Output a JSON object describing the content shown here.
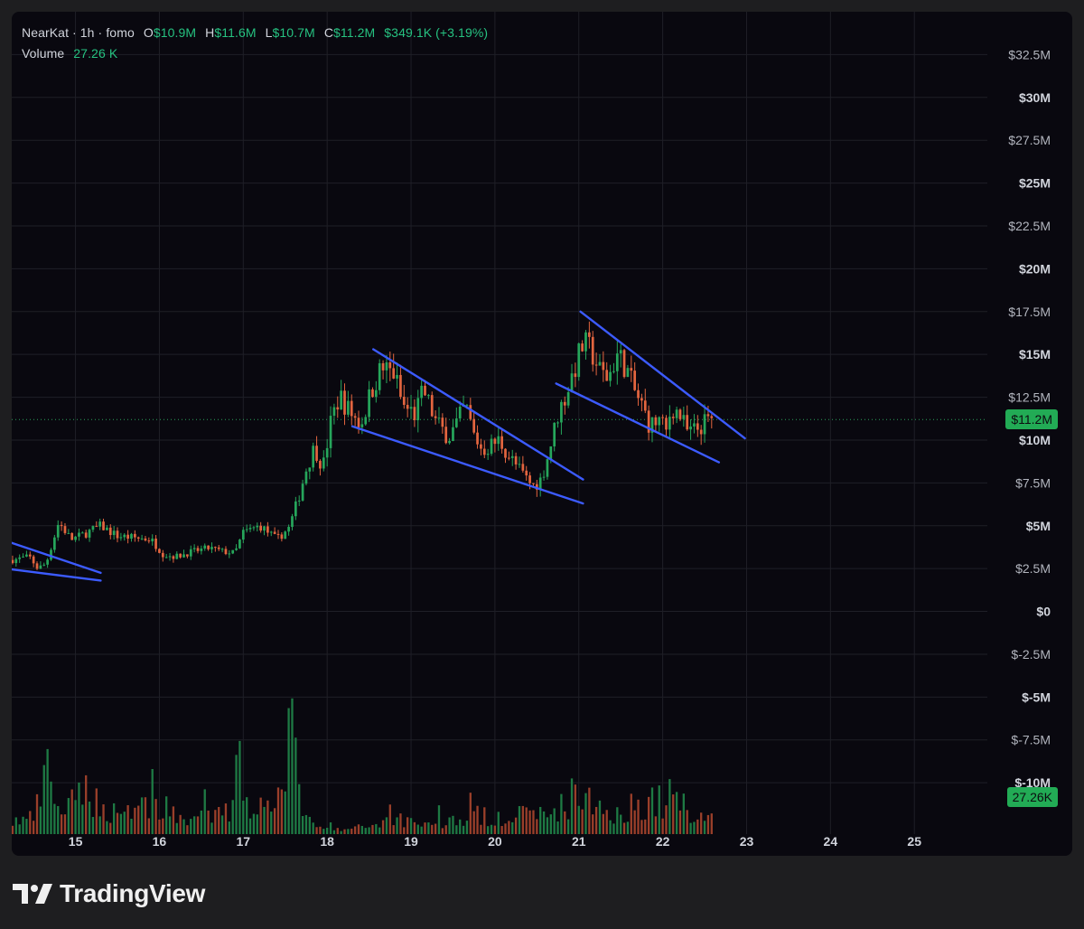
{
  "legend": {
    "symbol": "NearKat · 1h · fomo",
    "o_key": "O",
    "o_val": "$10.9M",
    "h_key": "H",
    "h_val": "$11.6M",
    "l_key": "L",
    "l_val": "$10.7M",
    "c_key": "C",
    "c_val": "$11.2M",
    "change": "$349.1K (+3.19%)",
    "volume_key": "Volume",
    "volume_val": "27.26 K"
  },
  "brand": {
    "name": "TradingView",
    "icon": "tradingview-logo-icon"
  },
  "colors": {
    "background": "#09080f",
    "frame": "#1e1e20",
    "grid": "#1f1f27",
    "up": "#26a65b",
    "down": "#e3653f",
    "trendline": "#3c5bff",
    "axis_text": "#b2b5be",
    "tag_bg": "#22ab55"
  },
  "chart_data": {
    "type": "candlestick",
    "interval": "1h",
    "y_axis": {
      "range": [
        -13,
        35
      ],
      "ticks": [
        {
          "value": 32.5,
          "label": "$32.5M",
          "bold": false
        },
        {
          "value": 30,
          "label": "$30M",
          "bold": true
        },
        {
          "value": 27.5,
          "label": "$27.5M",
          "bold": false
        },
        {
          "value": 25,
          "label": "$25M",
          "bold": true
        },
        {
          "value": 22.5,
          "label": "$22.5M",
          "bold": false
        },
        {
          "value": 20,
          "label": "$20M",
          "bold": true
        },
        {
          "value": 17.5,
          "label": "$17.5M",
          "bold": false
        },
        {
          "value": 15,
          "label": "$15M",
          "bold": true
        },
        {
          "value": 12.5,
          "label": "$12.5M",
          "bold": false
        },
        {
          "value": 10,
          "label": "$10M",
          "bold": true
        },
        {
          "value": 7.5,
          "label": "$7.5M",
          "bold": false
        },
        {
          "value": 5,
          "label": "$5M",
          "bold": true
        },
        {
          "value": 2.5,
          "label": "$2.5M",
          "bold": false
        },
        {
          "value": 0,
          "label": "$0",
          "bold": true
        },
        {
          "value": -2.5,
          "label": "$-2.5M",
          "bold": false
        },
        {
          "value": -5,
          "label": "$-5M",
          "bold": true
        },
        {
          "value": -7.5,
          "label": "$-7.5M",
          "bold": false
        },
        {
          "value": -10,
          "label": "$-10M",
          "bold": true
        }
      ]
    },
    "x_axis": {
      "range": [
        14.24,
        25.87
      ],
      "ticks": [
        {
          "value": 15,
          "label": "15"
        },
        {
          "value": 16,
          "label": "16"
        },
        {
          "value": 17,
          "label": "17"
        },
        {
          "value": 18,
          "label": "18"
        },
        {
          "value": 19,
          "label": "19"
        },
        {
          "value": 20,
          "label": "20"
        },
        {
          "value": 21,
          "label": "21"
        },
        {
          "value": 22,
          "label": "22"
        },
        {
          "value": 23,
          "label": "23"
        },
        {
          "value": 24,
          "label": "24"
        },
        {
          "value": 25,
          "label": "25"
        }
      ]
    },
    "last_price": {
      "value": 11.2,
      "label": "$11.2M"
    },
    "volume_tag": {
      "label": "27.26K"
    },
    "price_path": [
      [
        14.25,
        3.0
      ],
      [
        14.45,
        3.2
      ],
      [
        14.55,
        2.5
      ],
      [
        14.65,
        2.8
      ],
      [
        14.8,
        5.2
      ],
      [
        14.95,
        4.2
      ],
      [
        15.1,
        4.5
      ],
      [
        15.3,
        5.0
      ],
      [
        15.5,
        4.4
      ],
      [
        15.7,
        4.3
      ],
      [
        15.9,
        4.2
      ],
      [
        16.05,
        3.3
      ],
      [
        16.2,
        3.2
      ],
      [
        16.4,
        3.5
      ],
      [
        16.6,
        3.7
      ],
      [
        16.75,
        3.5
      ],
      [
        16.9,
        3.4
      ],
      [
        17.0,
        4.6
      ],
      [
        17.2,
        5.0
      ],
      [
        17.4,
        4.2
      ],
      [
        17.55,
        4.9
      ],
      [
        17.65,
        6.5
      ],
      [
        17.75,
        8.3
      ],
      [
        17.85,
        9.6
      ],
      [
        17.95,
        8.4
      ],
      [
        18.05,
        11.2
      ],
      [
        18.15,
        12.6
      ],
      [
        18.25,
        11.8
      ],
      [
        18.4,
        10.9
      ],
      [
        18.55,
        13.2
      ],
      [
        18.65,
        14.2
      ],
      [
        18.8,
        13.9
      ],
      [
        18.9,
        12.0
      ],
      [
        19.05,
        11.5
      ],
      [
        19.15,
        12.9
      ],
      [
        19.3,
        11.0
      ],
      [
        19.45,
        10.2
      ],
      [
        19.55,
        11.0
      ],
      [
        19.65,
        12.0
      ],
      [
        19.75,
        10.3
      ],
      [
        19.85,
        9.4
      ],
      [
        19.95,
        9.7
      ],
      [
        20.05,
        10.0
      ],
      [
        20.15,
        9.2
      ],
      [
        20.3,
        8.2
      ],
      [
        20.45,
        7.3
      ],
      [
        20.55,
        7.7
      ],
      [
        20.65,
        9.4
      ],
      [
        20.75,
        11.5
      ],
      [
        20.85,
        12.7
      ],
      [
        20.95,
        14.2
      ],
      [
        21.05,
        15.6
      ],
      [
        21.15,
        15.2
      ],
      [
        21.25,
        14.0
      ],
      [
        21.35,
        13.6
      ],
      [
        21.45,
        15.0
      ],
      [
        21.55,
        14.4
      ],
      [
        21.65,
        13.0
      ],
      [
        21.75,
        12.0
      ],
      [
        21.85,
        10.8
      ],
      [
        21.95,
        11.2
      ],
      [
        22.05,
        10.4
      ],
      [
        22.1,
        12.0
      ],
      [
        22.2,
        11.5
      ],
      [
        22.3,
        10.4
      ],
      [
        22.4,
        10.6
      ],
      [
        22.5,
        11.0
      ],
      [
        22.6,
        11.2
      ]
    ],
    "volume_path": [
      [
        14.25,
        0.6
      ],
      [
        14.5,
        0.8
      ],
      [
        14.7,
        3.2
      ],
      [
        14.8,
        1.0
      ],
      [
        15.0,
        1.5
      ],
      [
        15.15,
        2.4
      ],
      [
        15.3,
        1.1
      ],
      [
        15.6,
        1.2
      ],
      [
        15.9,
        1.5
      ],
      [
        16.2,
        0.8
      ],
      [
        16.6,
        0.8
      ],
      [
        16.85,
        1.1
      ],
      [
        16.95,
        4.2
      ],
      [
        17.05,
        1.4
      ],
      [
        17.3,
        1.3
      ],
      [
        17.55,
        5.0
      ],
      [
        17.65,
        3.0
      ],
      [
        17.75,
        0.8
      ],
      [
        17.85,
        0.3
      ],
      [
        18.2,
        0.2
      ],
      [
        18.5,
        0.4
      ],
      [
        18.8,
        0.8
      ],
      [
        19.2,
        0.5
      ],
      [
        19.6,
        0.7
      ],
      [
        20.0,
        0.9
      ],
      [
        20.4,
        0.9
      ],
      [
        20.6,
        0.9
      ],
      [
        20.85,
        1.5
      ],
      [
        21.0,
        2.2
      ],
      [
        21.2,
        1.1
      ],
      [
        21.5,
        1.1
      ],
      [
        21.8,
        1.6
      ],
      [
        22.0,
        1.6
      ],
      [
        22.15,
        1.9
      ],
      [
        22.3,
        1.2
      ],
      [
        22.5,
        0.8
      ],
      [
        22.6,
        0.8
      ]
    ],
    "volume_max": 5.0,
    "trendlines": [
      {
        "x1": 14.24,
        "y1": 4.0,
        "x2": 15.3,
        "y2": 2.25
      },
      {
        "x1": 14.24,
        "y1": 2.45,
        "x2": 15.3,
        "y2": 1.8
      },
      {
        "x1": 18.55,
        "y1": 15.3,
        "x2": 21.05,
        "y2": 7.7
      },
      {
        "x1": 18.3,
        "y1": 10.8,
        "x2": 21.05,
        "y2": 6.3
      },
      {
        "x1": 21.02,
        "y1": 17.5,
        "x2": 22.98,
        "y2": 10.1
      },
      {
        "x1": 20.73,
        "y1": 13.3,
        "x2": 22.67,
        "y2": 8.7
      }
    ]
  }
}
